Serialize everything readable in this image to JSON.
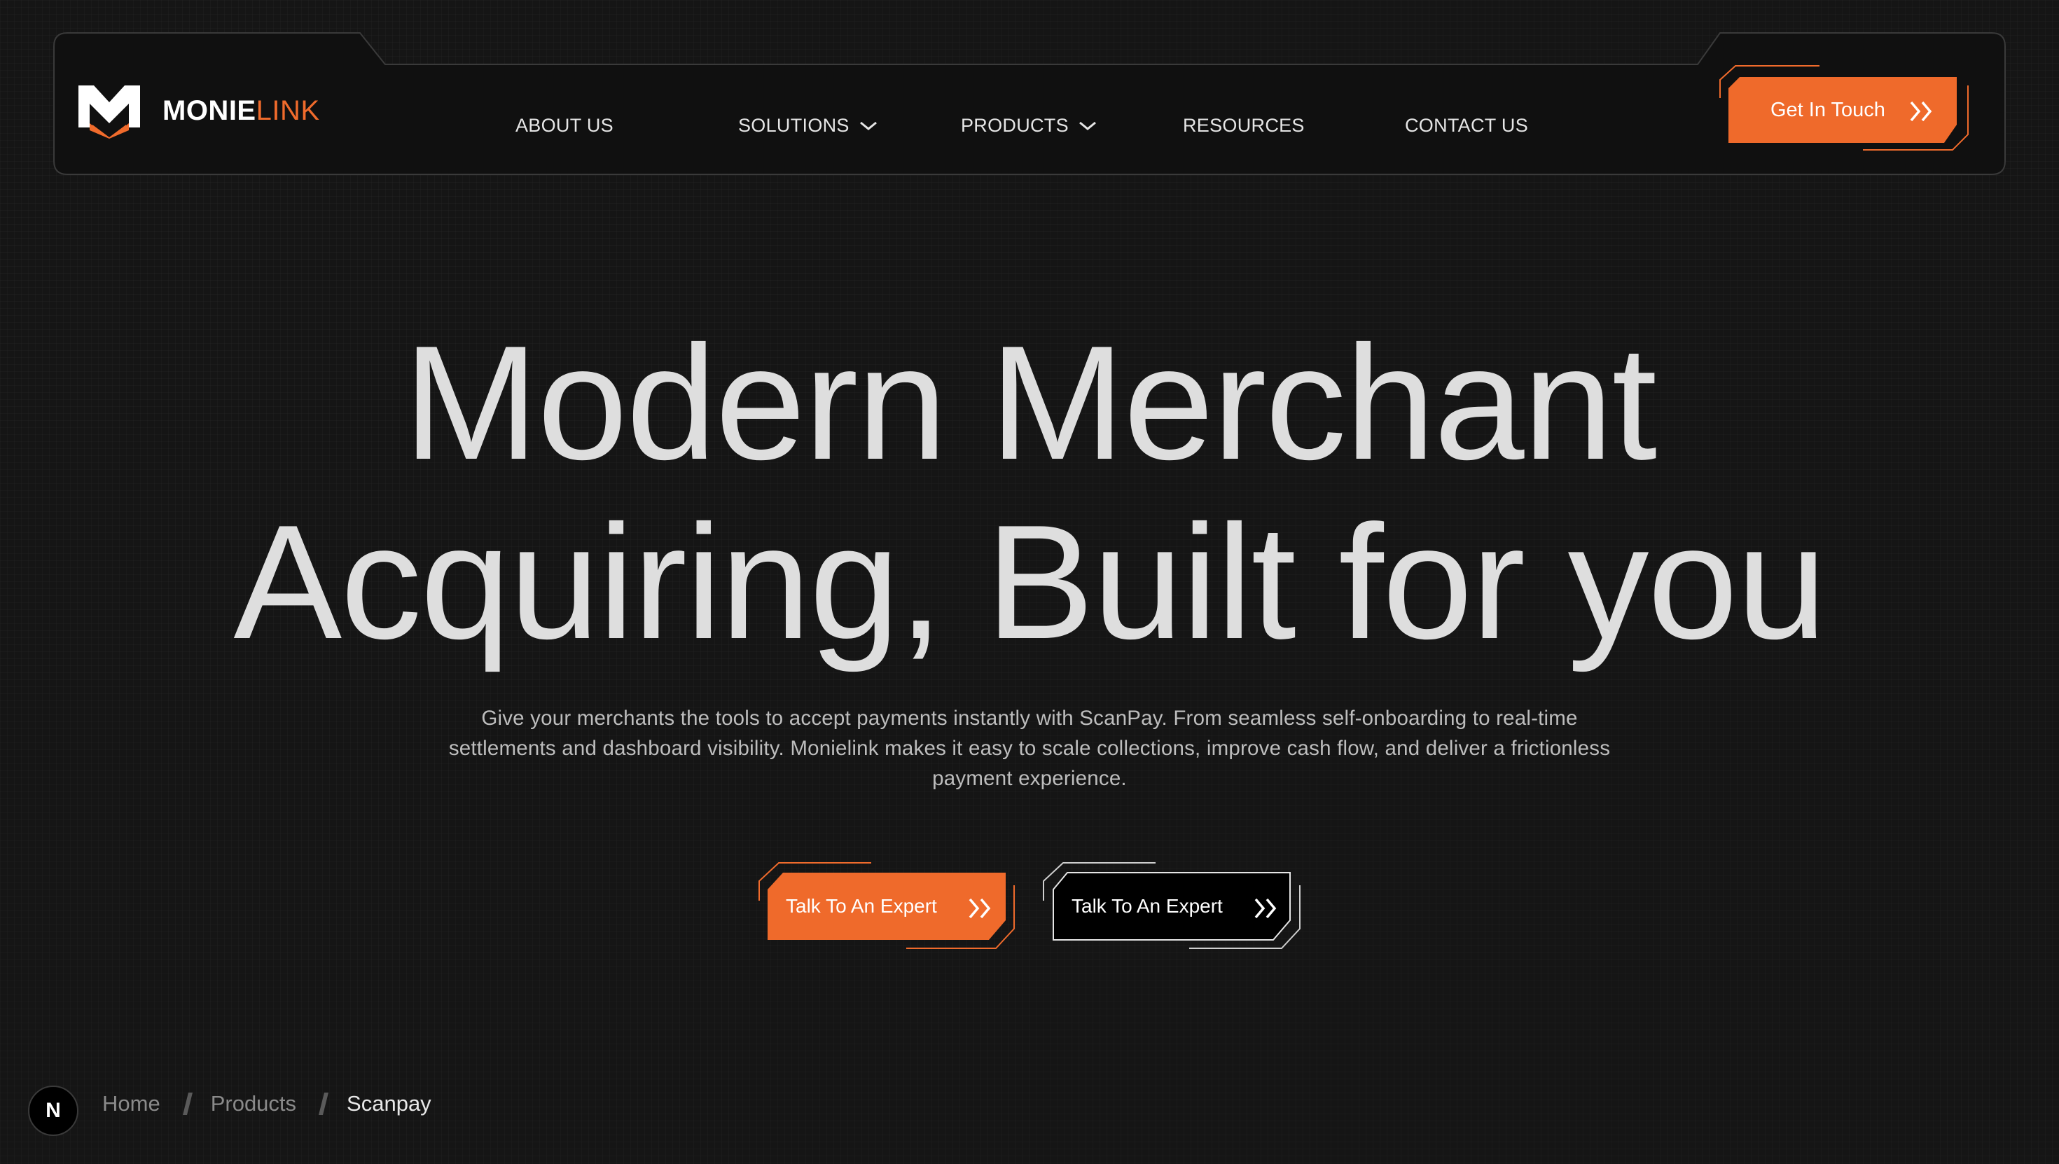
{
  "brand": {
    "name_primary": "MONIE",
    "name_accent": "LINK",
    "accent_color": "#f06b2c"
  },
  "nav": {
    "items": [
      {
        "label": "ABOUT US",
        "dropdown": false
      },
      {
        "label": "SOLUTIONS",
        "dropdown": true
      },
      {
        "label": "PRODUCTS",
        "dropdown": true
      },
      {
        "label": "RESOURCES",
        "dropdown": false
      },
      {
        "label": "CONTACT US",
        "dropdown": false
      }
    ],
    "cta_label": "Get In Touch",
    "cta_icon": "double-chevron-right-icon"
  },
  "hero": {
    "title_line1": "Modern Merchant",
    "title_line2": "Acquiring, Built for you",
    "subtitle": "Give your merchants the tools to accept payments instantly with ScanPay. From seamless self-onboarding to real-time settlements and dashboard visibility. Monielink makes it easy to scale collections, improve cash flow, and deliver a frictionless payment experience.",
    "primary_cta": "Talk To An Expert",
    "secondary_cta": "Talk To An Expert"
  },
  "breadcrumb": {
    "badge": "N",
    "items": [
      "Home",
      "Products",
      "Scanpay"
    ]
  }
}
